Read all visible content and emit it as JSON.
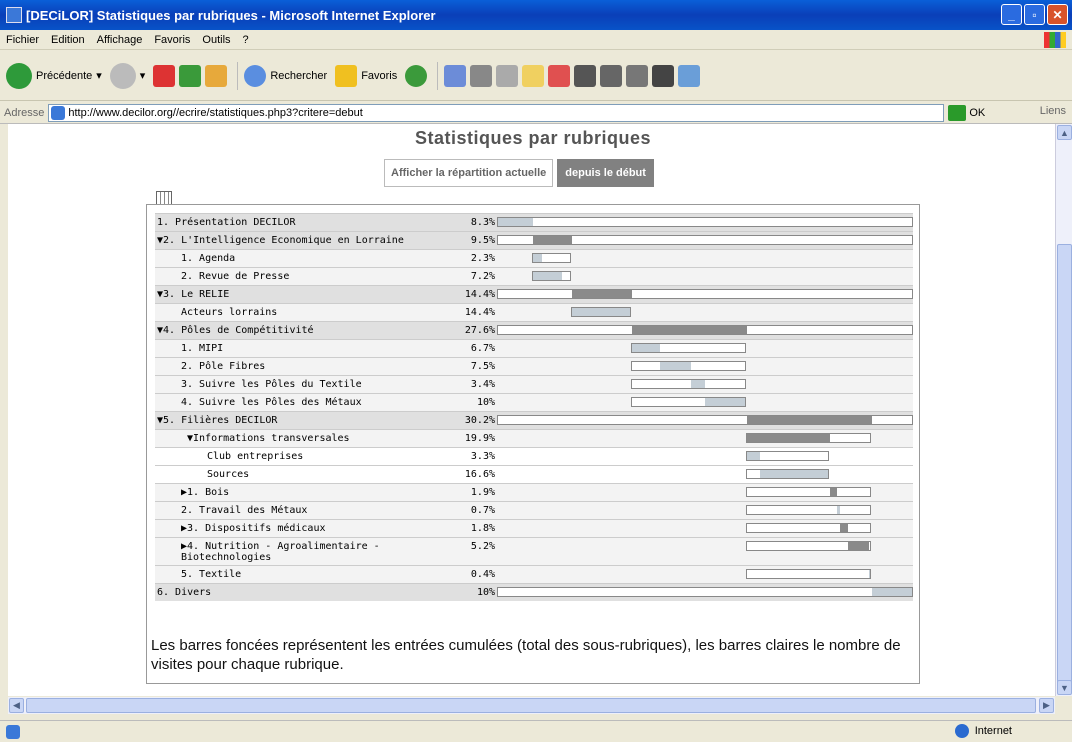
{
  "window": {
    "title": "[DECiLOR] Statistiques par rubriques - Microsoft Internet Explorer"
  },
  "menu": [
    "Fichier",
    "Edition",
    "Affichage",
    "Favoris",
    "Outils",
    "?"
  ],
  "toolbar": {
    "back_label": "Précédente",
    "search_label": "Rechercher",
    "favorites_label": "Favoris"
  },
  "address": {
    "label": "Adresse",
    "url": "http://www.decilor.org//ecrire/statistiques.php3?critere=debut",
    "go_label": "OK",
    "links_label": "Liens"
  },
  "status": {
    "zone": "Internet"
  },
  "page": {
    "title": "Statistiques par rubriques",
    "tab_current": "Afficher la répartition actuelle",
    "tab_since": "depuis le début",
    "note": "Les barres foncées représentent les entrées cumulées (total des sous-rubriques), les barres claires le nombre de visites pour chaque rubrique."
  },
  "rows": [
    {
      "label": "1. Présentation DECILOR",
      "pct": "8.3%",
      "level": 1,
      "indent": 0,
      "lines": 1,
      "bar_start": 0.0,
      "bar_total": 1.0,
      "dark_start": 0.0,
      "dark": 0.0,
      "light": 0.083
    },
    {
      "label": "▼2. L'Intelligence Economique en Lorraine",
      "pct": "9.5%",
      "level": 1,
      "indent": 0,
      "lines": 1,
      "bar_start": 0.0,
      "bar_total": 1.0,
      "dark_start": 0.083,
      "dark": 0.095,
      "light": 0.0
    },
    {
      "label": "1. Agenda",
      "pct": "2.3%",
      "level": 2,
      "indent": 1,
      "lines": 1,
      "bar_start": 0.083,
      "bar_total": 0.095,
      "dark_start": 0.0,
      "dark": 0.0,
      "light": 0.023
    },
    {
      "label": "2. Revue de Presse",
      "pct": "7.2%",
      "level": 2,
      "indent": 1,
      "lines": 1,
      "bar_start": 0.083,
      "bar_total": 0.095,
      "dark_start": 0.0,
      "dark": 0.0,
      "light": 0.072
    },
    {
      "label": "▼3. Le RELIE",
      "pct": "14.4%",
      "level": 1,
      "indent": 0,
      "lines": 1,
      "bar_start": 0.0,
      "bar_total": 1.0,
      "dark_start": 0.178,
      "dark": 0.144,
      "light": 0.0
    },
    {
      "label": "Acteurs lorrains",
      "pct": "14.4%",
      "level": 2,
      "indent": 1,
      "lines": 1,
      "bar_start": 0.178,
      "bar_total": 0.144,
      "dark_start": 0.0,
      "dark": 0.0,
      "light": 0.144
    },
    {
      "label": "▼4. Pôles de Compétitivité",
      "pct": "27.6%",
      "level": 1,
      "indent": 0,
      "lines": 1,
      "bar_start": 0.0,
      "bar_total": 1.0,
      "dark_start": 0.322,
      "dark": 0.276,
      "light": 0.0
    },
    {
      "label": "1. MIPI",
      "pct": "6.7%",
      "level": 2,
      "indent": 1,
      "lines": 1,
      "bar_start": 0.322,
      "bar_total": 0.276,
      "dark_start": 0.0,
      "dark": 0.0,
      "light": 0.067
    },
    {
      "label": "2. Pôle Fibres",
      "pct": "7.5%",
      "level": 2,
      "indent": 1,
      "lines": 1,
      "bar_start": 0.322,
      "bar_total": 0.276,
      "dark_start": 0.0,
      "dark": 0.0,
      "light": 0.075,
      "light_start": 0.067
    },
    {
      "label": "3. Suivre les Pôles du Textile",
      "pct": "3.4%",
      "level": 2,
      "indent": 1,
      "lines": 1,
      "bar_start": 0.322,
      "bar_total": 0.276,
      "dark_start": 0.0,
      "dark": 0.0,
      "light": 0.034,
      "light_start": 0.142
    },
    {
      "label": "4. Suivre les Pôles des Métaux",
      "pct": "10%",
      "level": 2,
      "indent": 1,
      "lines": 1,
      "bar_start": 0.322,
      "bar_total": 0.276,
      "dark_start": 0.0,
      "dark": 0.0,
      "light": 0.1,
      "light_start": 0.176
    },
    {
      "label": "▼5. Filières DECILOR",
      "pct": "30.2%",
      "level": 1,
      "indent": 0,
      "lines": 1,
      "bar_start": 0.0,
      "bar_total": 1.0,
      "dark_start": 0.598,
      "dark": 0.302,
      "light": 0.0
    },
    {
      "label": "▼Informations transversales",
      "pct": "19.9%",
      "level": 2,
      "indent": 2,
      "lines": 1,
      "bar_start": 0.598,
      "bar_total": 0.302,
      "dark_start": 0.0,
      "dark": 0.199,
      "light": 0.0
    },
    {
      "label": "Club entreprises",
      "pct": "3.3%",
      "level": 3,
      "indent": 3,
      "lines": 1,
      "bar_start": 0.598,
      "bar_total": 0.199,
      "dark_start": 0.0,
      "dark": 0.0,
      "light": 0.033
    },
    {
      "label": "Sources",
      "pct": "16.6%",
      "level": 3,
      "indent": 3,
      "lines": 1,
      "bar_start": 0.598,
      "bar_total": 0.199,
      "dark_start": 0.0,
      "dark": 0.0,
      "light": 0.166,
      "light_start": 0.033
    },
    {
      "label": "▶1. Bois",
      "pct": "1.9%",
      "level": 2,
      "indent": 1,
      "lines": 1,
      "bar_start": 0.598,
      "bar_total": 0.302,
      "dark_start": 0.199,
      "dark": 0.019,
      "light": 0.0
    },
    {
      "label": "2. Travail des Métaux",
      "pct": "0.7%",
      "level": 2,
      "indent": 1,
      "lines": 1,
      "bar_start": 0.598,
      "bar_total": 0.302,
      "dark_start": 0.0,
      "dark": 0.0,
      "light": 0.007,
      "light_start": 0.218
    },
    {
      "label": "▶3. Dispositifs médicaux",
      "pct": "1.8%",
      "level": 2,
      "indent": 1,
      "lines": 1,
      "bar_start": 0.598,
      "bar_total": 0.302,
      "dark_start": 0.225,
      "dark": 0.018,
      "light": 0.0
    },
    {
      "label": "▶4. Nutrition - Agroalimentaire - Biotechnologies",
      "pct": "5.2%",
      "level": 2,
      "indent": 1,
      "lines": 2,
      "bar_start": 0.598,
      "bar_total": 0.302,
      "dark_start": 0.243,
      "dark": 0.052,
      "light": 0.0
    },
    {
      "label": "5. Textile",
      "pct": "0.4%",
      "level": 2,
      "indent": 1,
      "lines": 1,
      "bar_start": 0.598,
      "bar_total": 0.302,
      "dark_start": 0.0,
      "dark": 0.0,
      "light": 0.004,
      "light_start": 0.295
    },
    {
      "label": "6. Divers",
      "pct": "10%",
      "level": 1,
      "indent": 0,
      "lines": 1,
      "bar_start": 0.0,
      "bar_total": 1.0,
      "dark_start": 0.0,
      "dark": 0.0,
      "light": 0.1,
      "light_start": 0.9
    }
  ],
  "colors": {
    "dark_bar": "#8a8a8a",
    "light_bar": "#c4ced6",
    "row_level1": "#e0e0e0",
    "row_level2": "#f3f3f3"
  }
}
